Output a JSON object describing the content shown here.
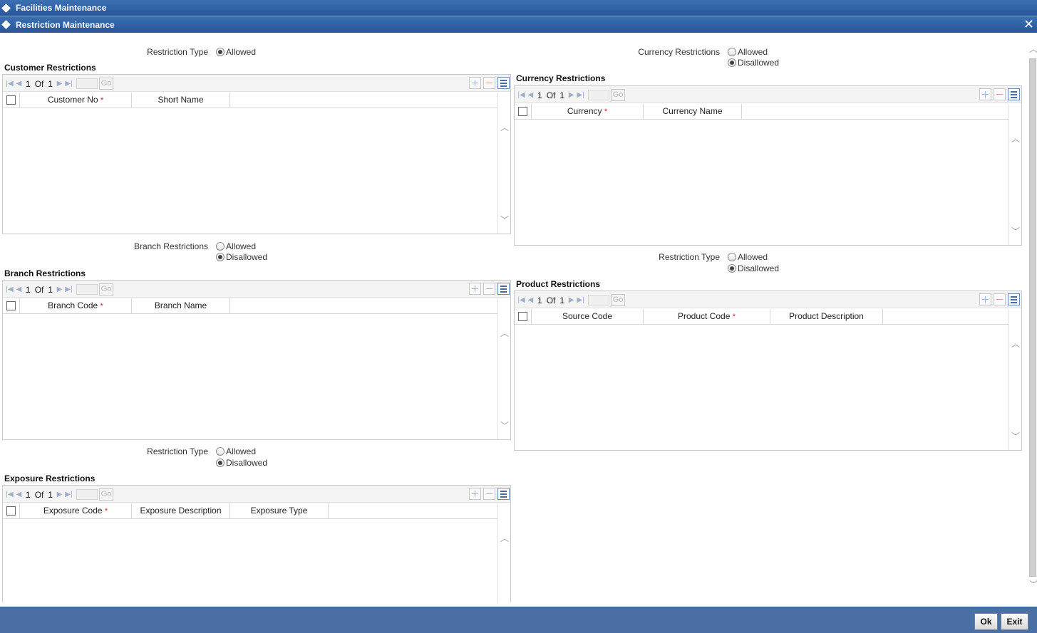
{
  "header": {
    "parent_title": "Facilities Maintenance",
    "title": "Restriction Maintenance",
    "close_icon": "close-icon"
  },
  "customer": {
    "type_label": "Restriction Type",
    "options": [
      "Allowed"
    ],
    "selected": "Allowed",
    "section_title": "Customer Restrictions",
    "grid": {
      "page": "1",
      "of_label": "Of",
      "total": "1",
      "go_label": "Go",
      "columns": [
        "Customer No",
        "Short Name"
      ],
      "required": [
        true,
        false
      ],
      "rows": []
    }
  },
  "currency": {
    "type_label": "Currency Restrictions",
    "options": [
      "Allowed",
      "Disallowed"
    ],
    "selected": "Disallowed",
    "section_title": "Currency Restrictions",
    "grid": {
      "page": "1",
      "of_label": "Of",
      "total": "1",
      "go_label": "Go",
      "columns": [
        "Currency",
        "Currency Name"
      ],
      "required": [
        true,
        false
      ],
      "rows": []
    }
  },
  "branch": {
    "type_label": "Branch Restrictions",
    "options": [
      "Allowed",
      "Disallowed"
    ],
    "selected": "Disallowed",
    "section_title": "Branch Restrictions",
    "grid": {
      "page": "1",
      "of_label": "Of",
      "total": "1",
      "go_label": "Go",
      "columns": [
        "Branch Code",
        "Branch Name"
      ],
      "required": [
        true,
        false
      ],
      "rows": []
    }
  },
  "product": {
    "type_label": "Restriction Type",
    "options": [
      "Allowed",
      "Disallowed"
    ],
    "selected": "Disallowed",
    "section_title": "Product Restrictions",
    "grid": {
      "page": "1",
      "of_label": "Of",
      "total": "1",
      "go_label": "Go",
      "columns": [
        "Source Code",
        "Product Code",
        "Product Description"
      ],
      "required": [
        false,
        true,
        false
      ],
      "rows": []
    }
  },
  "exposure": {
    "type_label": "Restriction Type",
    "options": [
      "Allowed",
      "Disallowed"
    ],
    "selected": "Disallowed",
    "section_title": "Exposure Restrictions",
    "grid": {
      "page": "1",
      "of_label": "Of",
      "total": "1",
      "go_label": "Go",
      "columns": [
        "Exposure Code",
        "Exposure Description",
        "Exposure Type"
      ],
      "required": [
        true,
        false,
        false
      ],
      "rows": []
    }
  },
  "footer": {
    "ok_label": "Ok",
    "exit_label": "Exit"
  },
  "colors": {
    "titlebar": "#24569a",
    "footer": "#4a6fa5",
    "required_marker": "#cc2222"
  }
}
